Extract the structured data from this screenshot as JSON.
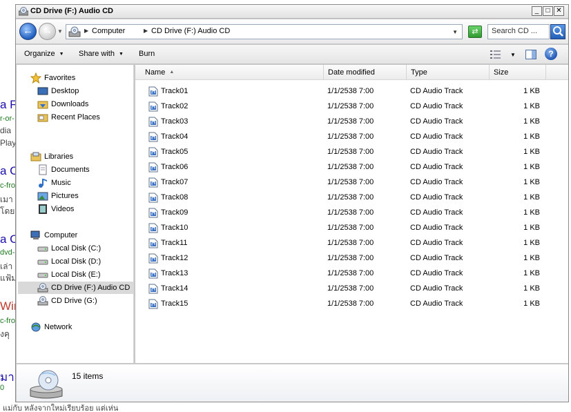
{
  "background_page": {
    "lines": [
      {
        "text": "a F",
        "kind": "title"
      },
      {
        "text": "r-or-",
        "kind": "url"
      },
      {
        "text": "dia",
        "kind": "text"
      },
      {
        "text": "Play",
        "kind": "text"
      },
      {
        "text": "a C",
        "kind": "title"
      },
      {
        "text": "c-fro",
        "kind": "url"
      },
      {
        "text": "เมา",
        "kind": "text"
      },
      {
        "text": "โดย",
        "kind": "text"
      },
      {
        "text": "a C",
        "kind": "title"
      },
      {
        "text": "dvd-",
        "kind": "url"
      },
      {
        "text": "เล่า",
        "kind": "text"
      },
      {
        "text": "แฟ้ม",
        "kind": "text"
      },
      {
        "text": "Wir",
        "kind": "title-red"
      },
      {
        "text": "c-fro",
        "kind": "url"
      },
      {
        "text": "งคุ",
        "kind": "text"
      },
      {
        "text": "มาเ",
        "kind": "title"
      },
      {
        "text": "0",
        "kind": "url"
      }
    ],
    "bottom_text": "แม่กับ หลังจากใหม่เรียบร้อย   แต่เห่น"
  },
  "window": {
    "title": "CD Drive (F:) Audio CD",
    "buttons": {
      "minimize": "_",
      "maximize": "□",
      "close": "✕"
    }
  },
  "address": {
    "crumbs": [
      "Computer",
      "CD Drive (F:) Audio CD"
    ],
    "search_placeholder": "Search CD ..."
  },
  "commands": {
    "organize": "Organize",
    "share_with": "Share with",
    "burn": "Burn"
  },
  "nav": {
    "favorites": {
      "header": "Favorites",
      "items": [
        "Desktop",
        "Downloads",
        "Recent Places"
      ]
    },
    "libraries": {
      "header": "Libraries",
      "items": [
        "Documents",
        "Music",
        "Pictures",
        "Videos"
      ]
    },
    "computer": {
      "header": "Computer",
      "items": [
        "Local Disk (C:)",
        "Local Disk (D:)",
        "Local Disk (E:)",
        "CD Drive (F:) Audio CD",
        "CD Drive (G:)"
      ]
    },
    "network": {
      "header": "Network"
    },
    "selected": "CD Drive (F:) Audio CD"
  },
  "columns": {
    "name": "Name",
    "date": "Date modified",
    "type": "Type",
    "size": "Size"
  },
  "files": [
    {
      "name": "Track01",
      "date": "1/1/2538 7:00",
      "type": "CD Audio Track",
      "size": "1 KB"
    },
    {
      "name": "Track02",
      "date": "1/1/2538 7:00",
      "type": "CD Audio Track",
      "size": "1 KB"
    },
    {
      "name": "Track03",
      "date": "1/1/2538 7:00",
      "type": "CD Audio Track",
      "size": "1 KB"
    },
    {
      "name": "Track04",
      "date": "1/1/2538 7:00",
      "type": "CD Audio Track",
      "size": "1 KB"
    },
    {
      "name": "Track05",
      "date": "1/1/2538 7:00",
      "type": "CD Audio Track",
      "size": "1 KB"
    },
    {
      "name": "Track06",
      "date": "1/1/2538 7:00",
      "type": "CD Audio Track",
      "size": "1 KB"
    },
    {
      "name": "Track07",
      "date": "1/1/2538 7:00",
      "type": "CD Audio Track",
      "size": "1 KB"
    },
    {
      "name": "Track08",
      "date": "1/1/2538 7:00",
      "type": "CD Audio Track",
      "size": "1 KB"
    },
    {
      "name": "Track09",
      "date": "1/1/2538 7:00",
      "type": "CD Audio Track",
      "size": "1 KB"
    },
    {
      "name": "Track10",
      "date": "1/1/2538 7:00",
      "type": "CD Audio Track",
      "size": "1 KB"
    },
    {
      "name": "Track11",
      "date": "1/1/2538 7:00",
      "type": "CD Audio Track",
      "size": "1 KB"
    },
    {
      "name": "Track12",
      "date": "1/1/2538 7:00",
      "type": "CD Audio Track",
      "size": "1 KB"
    },
    {
      "name": "Track13",
      "date": "1/1/2538 7:00",
      "type": "CD Audio Track",
      "size": "1 KB"
    },
    {
      "name": "Track14",
      "date": "1/1/2538 7:00",
      "type": "CD Audio Track",
      "size": "1 KB"
    },
    {
      "name": "Track15",
      "date": "1/1/2538 7:00",
      "type": "CD Audio Track",
      "size": "1 KB"
    }
  ],
  "status": {
    "item_count": "15 items"
  },
  "colors": {
    "window_frame": "#c7c7c7",
    "selected_nav": "#d9d9d9",
    "link_blue": "#1a0dab"
  }
}
